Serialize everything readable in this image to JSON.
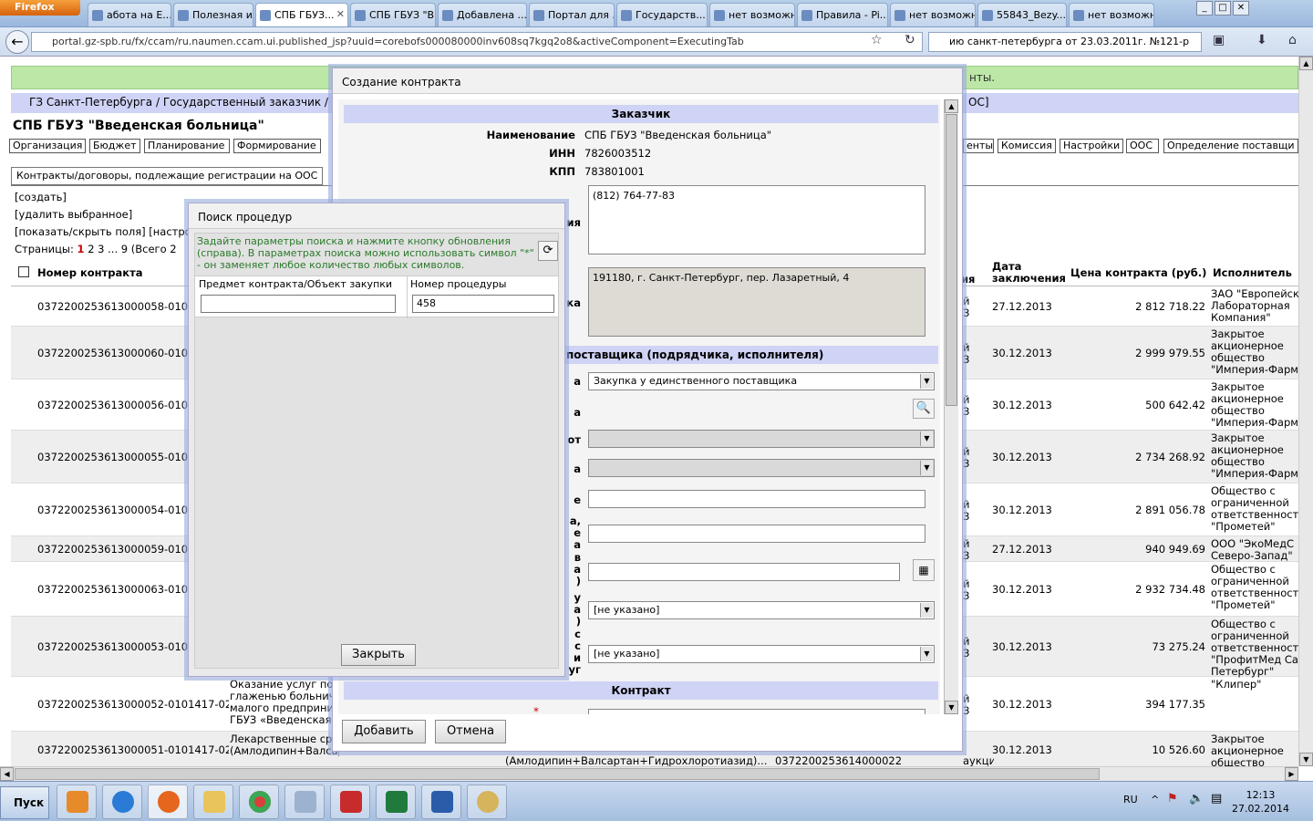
{
  "browser": {
    "menu_button": "Firefox",
    "tabs": [
      {
        "label": "абота на Е..."
      },
      {
        "label": "Полезная ин..."
      },
      {
        "label": "СПБ ГБУЗ..."
      },
      {
        "label": "СПБ ГБУЗ \"В..."
      },
      {
        "label": "Добавлена ..."
      },
      {
        "label": "Портал для ..."
      },
      {
        "label": "Государств..."
      },
      {
        "label": "нет возможн..."
      },
      {
        "label": "Правила - Pi..."
      },
      {
        "label": "нет возможн..."
      },
      {
        "label": "55843_Bezy..."
      },
      {
        "label": "нет возможн..."
      }
    ],
    "url": "portal.gz-spb.ru/fx/ccam/ru.naumen.ccam.ui.published_jsp?uuid=corebofs000080000inv608sq7kgq2o8&activeComponent=ExecutingTab",
    "search_text": "ию санкт-петербурга от 23.03.2011г. №121-р"
  },
  "page": {
    "banner": "нты.",
    "breadcrumb": "ГЗ Санкт-Петербурга / Государственный заказчик / Кон",
    "breadcrumb_right": "ОС]",
    "org_title": "СПБ ГБУЗ \"Введенская больница\"",
    "nav_tabs_left": [
      "Организация",
      "Бюджет",
      "Планирование",
      "Формирование"
    ],
    "nav_tabs_right": [
      "енты",
      "Комиссия",
      "Настройки",
      "ООС",
      "Определение поставщи"
    ],
    "contracts_tab": "Контракты/договоры, подлежащие регистрации на ООС",
    "actions": [
      "[создать]",
      "[удалить выбранное]",
      "[показать/скрыть поля] [настро"
    ],
    "pages_label": "Страницы:",
    "pages": [
      "1",
      "2",
      "3",
      "... 9"
    ],
    "pages_total": "(Всего 2",
    "columns": {
      "number": "Номер контракта",
      "method_part": "ия",
      "date": "Дата заключения",
      "price": "Цена контракта (руб.)",
      "supplier": "Исполнитель"
    },
    "rows": [
      {
        "number": "0372200253613000058-0101",
        "method": "й\nЗ",
        "date": "27.12.2013",
        "price": "2 812 718.22",
        "supplier": "ЗАО \"Европейск\nЛабораторная\nКомпания\""
      },
      {
        "number": "0372200253613000060-0101",
        "method": "й\nЗ",
        "date": "30.12.2013",
        "price": "2 999 979.55",
        "supplier": "Закрытое\nакционерное\nобщество\n\"Империя-Фарма"
      },
      {
        "number": "0372200253613000056-0101",
        "method": "й\nЗ",
        "date": "30.12.2013",
        "price": "500 642.42",
        "supplier": "Закрытое\nакционерное\nобщество\n\"Империя-Фарма"
      },
      {
        "number": "0372200253613000055-0101",
        "method": "й\nЗ",
        "date": "30.12.2013",
        "price": "2 734 268.92",
        "supplier": "Закрытое\nакционерное\nобщество\n\"Империя-Фарма"
      },
      {
        "number": "0372200253613000054-0101",
        "method": "й\nЗ",
        "date": "30.12.2013",
        "price": "2 891 056.78",
        "supplier": "Общество с\nограниченной\nответственность\n\"Прометей\""
      },
      {
        "number": "0372200253613000059-0101",
        "method": "й\nЗ",
        "date": "27.12.2013",
        "price": "940 949.69",
        "supplier": "ООО \"ЭкоМедС\nСеверо-Запад\""
      },
      {
        "number": "0372200253613000063-0101",
        "method": "й\nЗ",
        "date": "30.12.2013",
        "price": "2 932 734.48",
        "supplier": "Общество с\nограниченной\nответственность\n\"Прометей\""
      },
      {
        "number": "0372200253613000053-0101",
        "method": "й\nЗ",
        "date": "30.12.2013",
        "price": "73 275.24",
        "supplier": "Общество с\nограниченной\nответственность\n\"ПрофитМед Сан\nПетербург\""
      },
      {
        "number": "0372200253613000052-0101417-02",
        "subject": "Оказание услуг по\nглаженью больнич\nмалого предприни\nГБУЗ «Введенская",
        "method": "й\nЗ",
        "date": "30.12.2013",
        "price": "394 177.35",
        "supplier": "\"Клипер\""
      },
      {
        "number": "0372200253613000051-0101417-02",
        "subject": "Лекарственные ср\n(Амлодипин+Валсартан+Гидрохлоротиазид) для",
        "subject2": "(Амлодипин+Валсартан+Гидрохлоротиазид)...",
        "proc": "0372200253614000022",
        "method": "аукцион94ФЗ",
        "date": "30.12.2013",
        "price": "10 526.60",
        "supplier": "Закрытое\nакционерное\nобщество"
      }
    ]
  },
  "create_dialog": {
    "title": "Создание контракта",
    "section_customer": "Заказчик",
    "name_label": "Наименование",
    "name_value": "СПБ ГБУЗ \"Введенская больница\"",
    "inn_label": "ИНН",
    "inn_value": "7826003512",
    "kpp_label": "КПП",
    "kpp_value": "783801001",
    "partial_label_phone": "ия",
    "phone_value": "(812) 764-77-83",
    "partial_label_address": "ка",
    "address_value": "191180, г. Санкт-Петербург, пер. Лазаретный, 4",
    "section_supplier": "поставщика (подрядчика, исполнителя)",
    "label_method": "а",
    "method_value": "Закупка у единственного поставщика",
    "label_proc": "а",
    "label_basis": "от",
    "label_basis2": "а",
    "label_e": "е",
    "label_multi1": "а,\nе\nа",
    "label_multi2": "в\nа\n)",
    "label_multi3": "у\nа\n)",
    "select_unspecified_1": "[не указано]",
    "label_multi4": "с\nс\nи\nуг",
    "select_unspecified_2": "[не указано]",
    "section_contract": "Контракт",
    "add_button": "Добавить",
    "cancel_button": "Отмена"
  },
  "search_dialog": {
    "title": "Поиск процедур",
    "hint": "Задайте параметры поиска и нажмите кнопку обновления (справа). В параметрах поиска можно использовать символ \"*\" - он заменяет любое количество любых символов.",
    "subject_label": "Предмет контракта/Объект закупки",
    "subject_value": "",
    "proc_number_label": "Номер процедуры",
    "proc_number_value": "458",
    "close_button": "Закрыть"
  },
  "taskbar": {
    "start": "Пуск",
    "lang": "RU",
    "time": "12:13",
    "date": "27.02.2014"
  }
}
